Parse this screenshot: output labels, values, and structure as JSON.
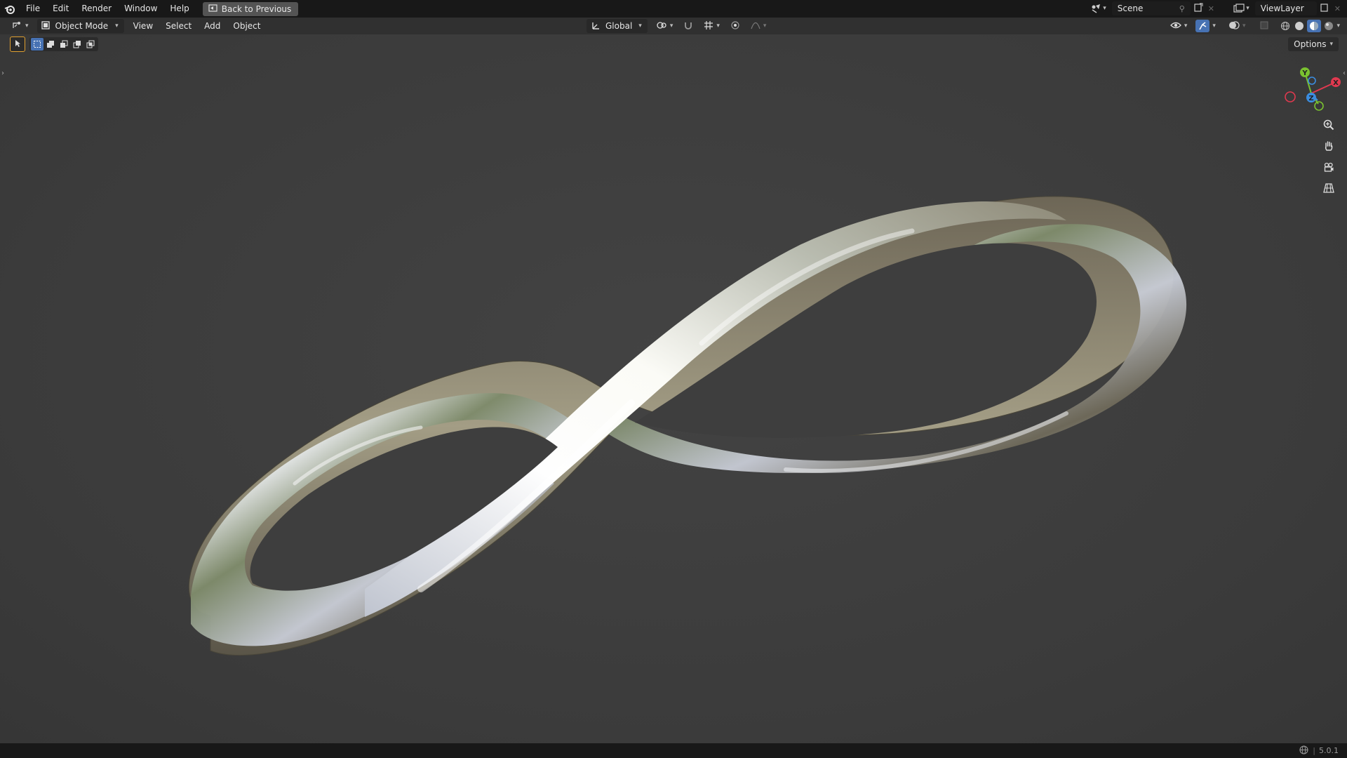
{
  "topbar": {
    "menus": [
      "File",
      "Edit",
      "Render",
      "Window",
      "Help"
    ],
    "back_label": "Back to Previous",
    "scene": "Scene",
    "view_layer": "ViewLayer"
  },
  "header": {
    "mode": "Object Mode",
    "menus": [
      "View",
      "Select",
      "Add",
      "Object"
    ],
    "orientation": "Global"
  },
  "viewport": {
    "options_label": "Options",
    "gizmo": {
      "x": "X",
      "y": "Y",
      "z": "Z"
    }
  },
  "status": {
    "version": "5.0.1"
  },
  "colors": {
    "accent": "#4772b3",
    "axis_x": "#e0394f",
    "axis_y": "#7ac130",
    "axis_z": "#3b8de0"
  },
  "icons": [
    "blender-logo-icon",
    "back-icon",
    "editor-type-icon",
    "object-mode-icon",
    "transform-orientation-icon",
    "pivot-icon",
    "snap-icon",
    "proportional-icon",
    "visibility-icon",
    "gizmo-icon",
    "overlay-icon",
    "xray-icon",
    "wireframe-shading-icon",
    "solid-shading-icon",
    "material-shading-icon",
    "rendered-shading-icon",
    "zoom-icon",
    "pan-hand-icon",
    "camera-icon",
    "grid-icon",
    "network-icon"
  ]
}
